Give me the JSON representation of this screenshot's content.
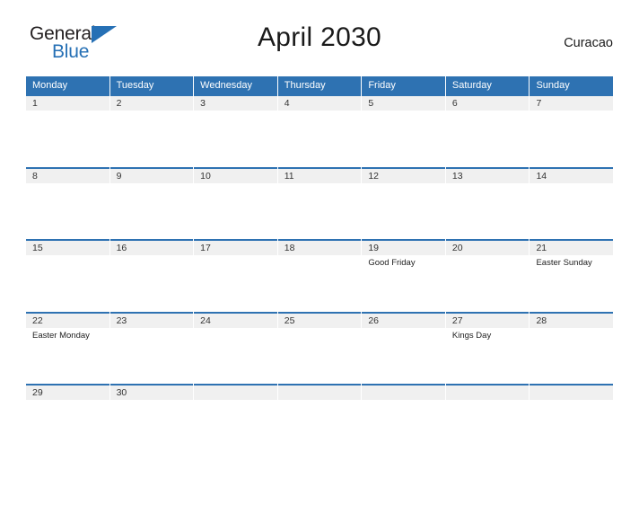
{
  "branding": {
    "logo_text_primary": "General",
    "logo_text_secondary": "Blue",
    "logo_triangle_color": "#2670b5"
  },
  "header": {
    "title": "April 2030",
    "region": "Curacao"
  },
  "theme": {
    "header_blue": "#2e72b2",
    "day_band_gray": "#f0f0f0",
    "text_dark": "#1a1a1a",
    "text_white": "#ffffff"
  },
  "calendar": {
    "month": "April",
    "year": "2030",
    "weekdays": [
      "Monday",
      "Tuesday",
      "Wednesday",
      "Thursday",
      "Friday",
      "Saturday",
      "Sunday"
    ],
    "weeks": [
      [
        {
          "day": "1",
          "events": []
        },
        {
          "day": "2",
          "events": []
        },
        {
          "day": "3",
          "events": []
        },
        {
          "day": "4",
          "events": []
        },
        {
          "day": "5",
          "events": []
        },
        {
          "day": "6",
          "events": []
        },
        {
          "day": "7",
          "events": []
        }
      ],
      [
        {
          "day": "8",
          "events": []
        },
        {
          "day": "9",
          "events": []
        },
        {
          "day": "10",
          "events": []
        },
        {
          "day": "11",
          "events": []
        },
        {
          "day": "12",
          "events": []
        },
        {
          "day": "13",
          "events": []
        },
        {
          "day": "14",
          "events": []
        }
      ],
      [
        {
          "day": "15",
          "events": []
        },
        {
          "day": "16",
          "events": []
        },
        {
          "day": "17",
          "events": []
        },
        {
          "day": "18",
          "events": []
        },
        {
          "day": "19",
          "events": [
            "Good Friday"
          ]
        },
        {
          "day": "20",
          "events": []
        },
        {
          "day": "21",
          "events": [
            "Easter Sunday"
          ]
        }
      ],
      [
        {
          "day": "22",
          "events": [
            "Easter Monday"
          ]
        },
        {
          "day": "23",
          "events": []
        },
        {
          "day": "24",
          "events": []
        },
        {
          "day": "25",
          "events": []
        },
        {
          "day": "26",
          "events": []
        },
        {
          "day": "27",
          "events": [
            "Kings Day"
          ]
        },
        {
          "day": "28",
          "events": []
        }
      ],
      [
        {
          "day": "29",
          "events": []
        },
        {
          "day": "30",
          "events": []
        },
        {
          "day": "",
          "events": []
        },
        {
          "day": "",
          "events": []
        },
        {
          "day": "",
          "events": []
        },
        {
          "day": "",
          "events": []
        },
        {
          "day": "",
          "events": []
        }
      ]
    ]
  }
}
